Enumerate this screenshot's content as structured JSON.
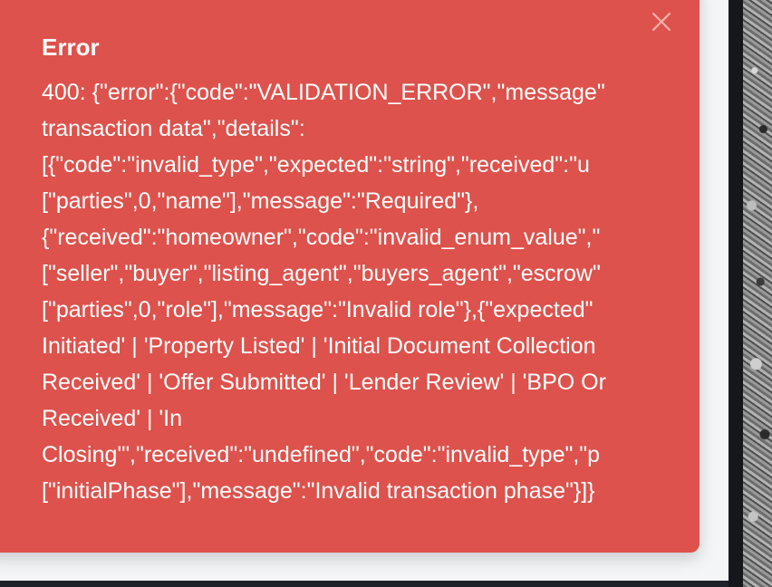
{
  "toast": {
    "title": "Error",
    "close_icon": "close-icon",
    "background_color": "#dd524c",
    "message_lines": [
      "400: {\"error\":{\"code\":\"VALIDATION_ERROR\",\"message\"",
      "transaction data\",\"details\":",
      "[{\"code\":\"invalid_type\",\"expected\":\"string\",\"received\":\"u",
      "[\"parties\",0,\"name\"],\"message\":\"Required\"},",
      "{\"received\":\"homeowner\",\"code\":\"invalid_enum_value\",\"",
      "[\"seller\",\"buyer\",\"listing_agent\",\"buyers_agent\",\"escrow\"",
      "[\"parties\",0,\"role\"],\"message\":\"Invalid role\"},{\"expected\"",
      "Initiated' | 'Property Listed' | 'Initial Document Collection",
      "Received' | 'Offer Submitted' | 'Lender Review' | 'BPO Or",
      "Received' | 'In",
      "Closing'\",\"received\":\"undefined\",\"code\":\"invalid_type\",\"p",
      "[\"initialPhase\"],\"message\":\"Invalid transaction phase\"}]}"
    ]
  }
}
